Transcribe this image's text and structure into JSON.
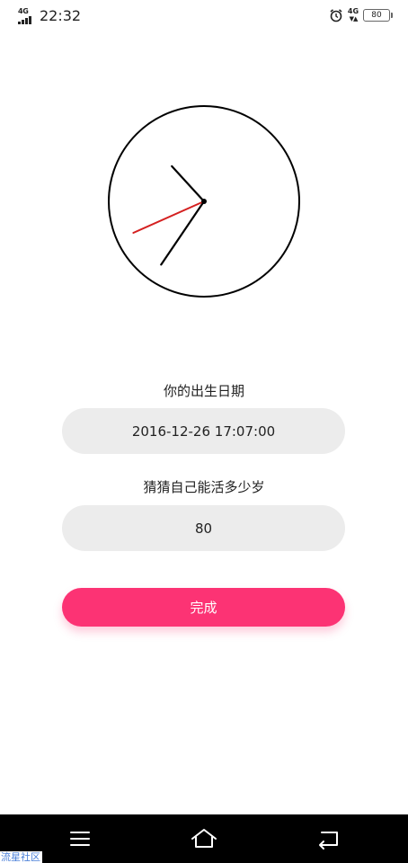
{
  "status_bar": {
    "network_left": "4G",
    "time": "22:32",
    "network_right": "4G",
    "battery": "80"
  },
  "clock": {
    "hour": 10,
    "minute": 35,
    "second": 41,
    "colors": {
      "face": "#000000",
      "hour_minute_hands": "#000000",
      "second_hand": "#d42020"
    }
  },
  "form": {
    "birth_label": "你的出生日期",
    "birth_value": "2016-12-26 17:07:00",
    "lifespan_label": "猜猜自己能活多少岁",
    "lifespan_value": "80",
    "done_button": "完成"
  },
  "colors": {
    "accent": "#fc3374",
    "field_bg": "#ececec"
  },
  "nav_bar": {
    "icons": [
      "menu-icon",
      "home-icon",
      "back-icon"
    ]
  },
  "watermark": "流星社区"
}
